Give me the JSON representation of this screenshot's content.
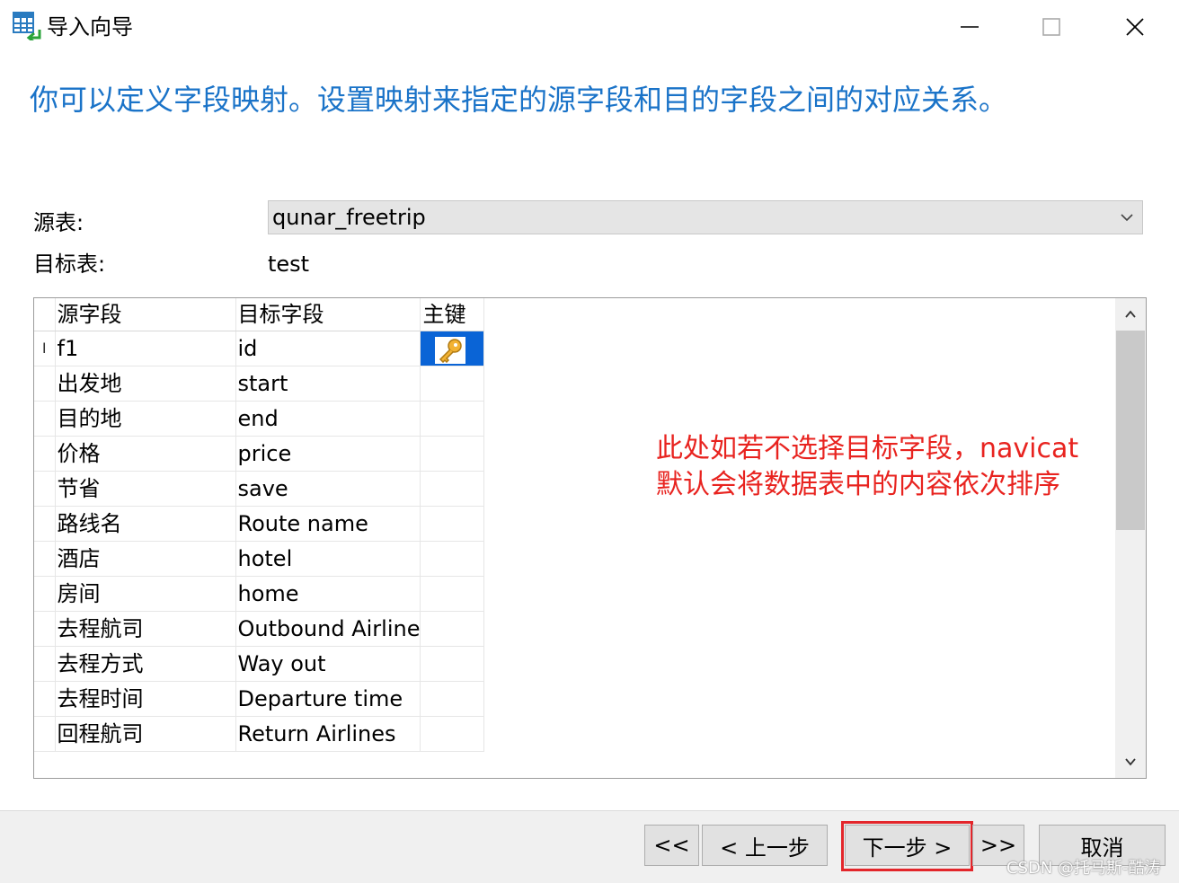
{
  "window": {
    "title": "导入向导",
    "heading": "你可以定义字段映射。设置映射来指定的源字段和目的字段之间的对应关系。"
  },
  "source": {
    "label": "源表:",
    "value": "qunar_freetrip"
  },
  "target": {
    "label": "目标表:",
    "value": "test"
  },
  "grid": {
    "columns": [
      "源字段",
      "目标字段",
      "主键"
    ],
    "rows": [
      {
        "source": "f1",
        "target": "id",
        "primary_key": true
      },
      {
        "source": "出发地",
        "target": "start",
        "primary_key": false
      },
      {
        "source": "目的地",
        "target": "end",
        "primary_key": false
      },
      {
        "source": "价格",
        "target": "price",
        "primary_key": false
      },
      {
        "source": "节省",
        "target": "save",
        "primary_key": false
      },
      {
        "source": "路线名",
        "target": "Route name",
        "primary_key": false
      },
      {
        "source": "酒店",
        "target": "hotel",
        "primary_key": false
      },
      {
        "source": "房间",
        "target": "home",
        "primary_key": false
      },
      {
        "source": "去程航司",
        "target": "Outbound Airline",
        "primary_key": false
      },
      {
        "source": "去程方式",
        "target": "Way out",
        "primary_key": false
      },
      {
        "source": "去程时间",
        "target": "Departure time",
        "primary_key": false
      },
      {
        "source": "回程航司",
        "target": "Return Airlines",
        "primary_key": false
      }
    ],
    "current_row_indicator": "I"
  },
  "annotation": {
    "line1": "此处如若不选择目标字段，navicat",
    "line2": "默认会将数据表中的内容依次排序",
    "color": "#e8231f"
  },
  "buttons": {
    "first": "<<",
    "prev": "< 上一步",
    "next": "下一步 >",
    "last": ">>",
    "cancel": "取消"
  },
  "watermark": "CSDN @托马斯-酷涛",
  "colors": {
    "heading": "#1a73c8",
    "selection": "#0a64d6",
    "highlight_box": "#e3262b"
  },
  "icons": [
    "table-import-icon",
    "minimize-icon",
    "maximize-icon",
    "close-icon",
    "chevron-down-icon",
    "key-icon",
    "chevron-up-icon"
  ]
}
